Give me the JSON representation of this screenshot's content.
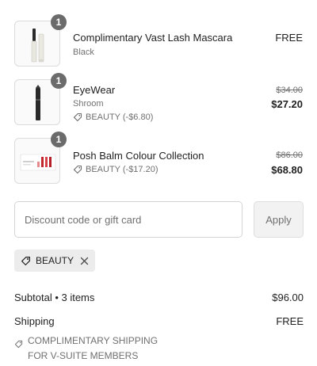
{
  "items": [
    {
      "name": "Complimentary Vast Lash Mascara",
      "variant": "Black",
      "quantity": "1",
      "price": "FREE",
      "image_icon": "mascara-icon"
    },
    {
      "name": "EyeWear",
      "variant": "Shroom",
      "quantity": "1",
      "discount": "BEAUTY (-$6.80)",
      "original_price": "$34.00",
      "price": "$27.20",
      "image_icon": "eyeliner-pencil-icon"
    },
    {
      "name": "Posh Balm Colour Collection",
      "quantity": "1",
      "discount": "BEAUTY (-$17.20)",
      "original_price": "$86.00",
      "price": "$68.80",
      "image_icon": "lip-balm-set-icon"
    }
  ],
  "discount_form": {
    "placeholder": "Discount code or gift card",
    "value": "",
    "apply_label": "Apply"
  },
  "applied_code": {
    "label": "BEAUTY",
    "tag_icon": "tag-icon",
    "remove_icon": "close-icon"
  },
  "summary": {
    "subtotal_label": "Subtotal • 3 items",
    "subtotal_value": "$96.00",
    "shipping_label": "Shipping",
    "shipping_value": "FREE",
    "shipping_note_line1": "COMPLIMENTARY SHIPPING",
    "shipping_note_line2": "FOR V-SUITE MEMBERS"
  },
  "colors": {
    "badge": "#6b6b6b",
    "muted_text": "#707070",
    "chip_bg": "#ececec",
    "apply_bg": "#f2f2f2"
  }
}
